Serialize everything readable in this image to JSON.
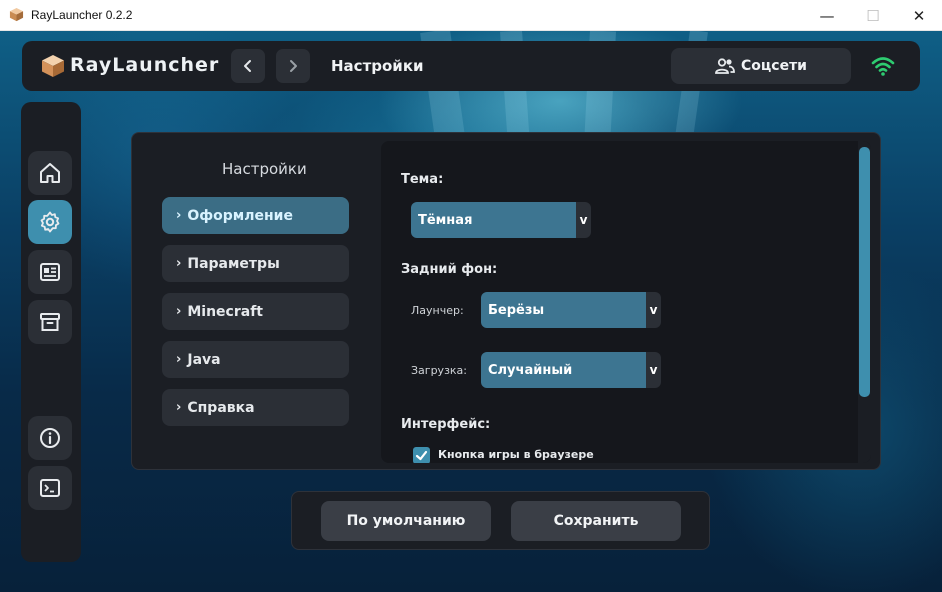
{
  "window": {
    "title": "RayLauncher 0.2.2",
    "minimize_glyph": "—",
    "maximize_glyph": "☐",
    "close_glyph": "✕"
  },
  "header": {
    "logo_text": "RayLauncher",
    "page_title": "Настройки",
    "social_label": "Соцсети",
    "icons": {
      "logo": "cube-logo-icon",
      "back": "chevron-left-icon",
      "forward": "chevron-right-icon",
      "social": "users-icon",
      "status": "wifi-icon"
    }
  },
  "sidebar": {
    "items": [
      {
        "name": "home",
        "icon": "home-icon",
        "active": false
      },
      {
        "name": "settings",
        "icon": "gear-icon",
        "active": true
      },
      {
        "name": "news",
        "icon": "newspaper-icon",
        "active": false
      },
      {
        "name": "archive",
        "icon": "archive-icon",
        "active": false
      },
      {
        "name": "info",
        "icon": "info-icon",
        "active": false
      },
      {
        "name": "console",
        "icon": "terminal-icon",
        "active": false
      }
    ]
  },
  "settings": {
    "title": "Настройки",
    "menu": [
      {
        "label": "Оформление",
        "active": true
      },
      {
        "label": "Параметры",
        "active": false
      },
      {
        "label": "Minecraft",
        "active": false
      },
      {
        "label": "Java",
        "active": false
      },
      {
        "label": "Справка",
        "active": false
      }
    ],
    "chevron": "›",
    "theme": {
      "label": "Тема:",
      "value": "Тёмная"
    },
    "background": {
      "label": "Задний фон:",
      "launcher_label": "Лаунчер:",
      "launcher_value": "Берёзы",
      "loading_label": "Загрузка:",
      "loading_value": "Случайный"
    },
    "interface": {
      "label": "Интерфейс:",
      "browser_game_button_label": "Кнопка игры в браузере",
      "browser_game_button_checked": true
    },
    "dropdown_arrow": "v"
  },
  "footer": {
    "default_label": "По умолчанию",
    "save_label": "Сохранить"
  },
  "colors": {
    "accent": "#3e8fae",
    "panel": "#1b1e24",
    "button": "#2b2f36",
    "select": "#3d7591",
    "wifi": "#2ecc71"
  }
}
